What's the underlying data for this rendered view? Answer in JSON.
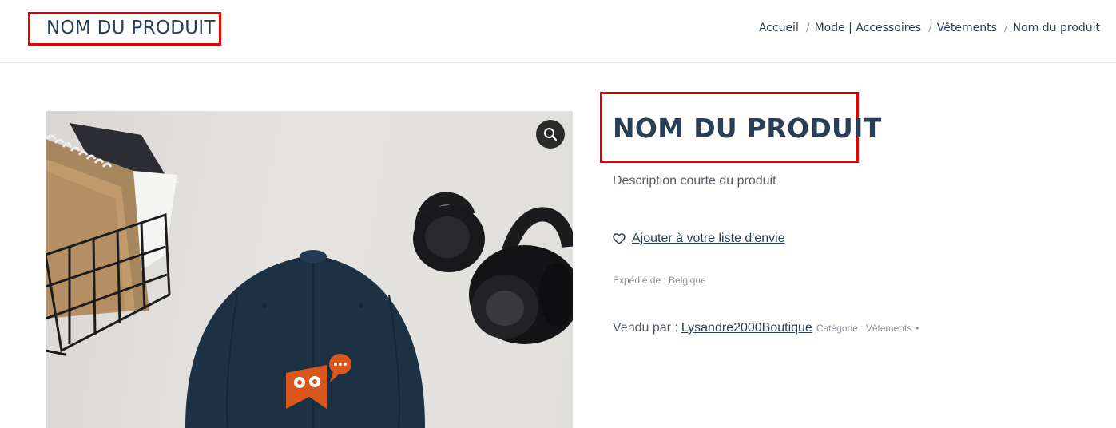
{
  "header": {
    "page_title": "NOM DU PRODUIT",
    "breadcrumb": [
      {
        "label": "Accueil"
      },
      {
        "label": "Mode | Accessoires"
      },
      {
        "label": "Vêtements"
      },
      {
        "label": "Nom du produit"
      }
    ],
    "separator": "/"
  },
  "product": {
    "title": "NOM DU PRODUIT",
    "short_description": "Description courte du produit",
    "wishlist_label": "Ajouter à votre liste d'envie",
    "shipped_from": "Expédié de : Belgique",
    "sold_by_prefix": "Vendu par :",
    "vendor_name": "Lysandre2000Boutique",
    "category_text": "Catégorie : Vêtements",
    "category_dot": "•"
  },
  "colors": {
    "highlight_border": "#e60000",
    "heading_text": "#2a3f55",
    "cap_navy": "#1d3144",
    "logo_orange": "#d9561d"
  },
  "icons": {
    "zoom": "magnifier-icon",
    "wishlist": "heart-outline-icon"
  }
}
